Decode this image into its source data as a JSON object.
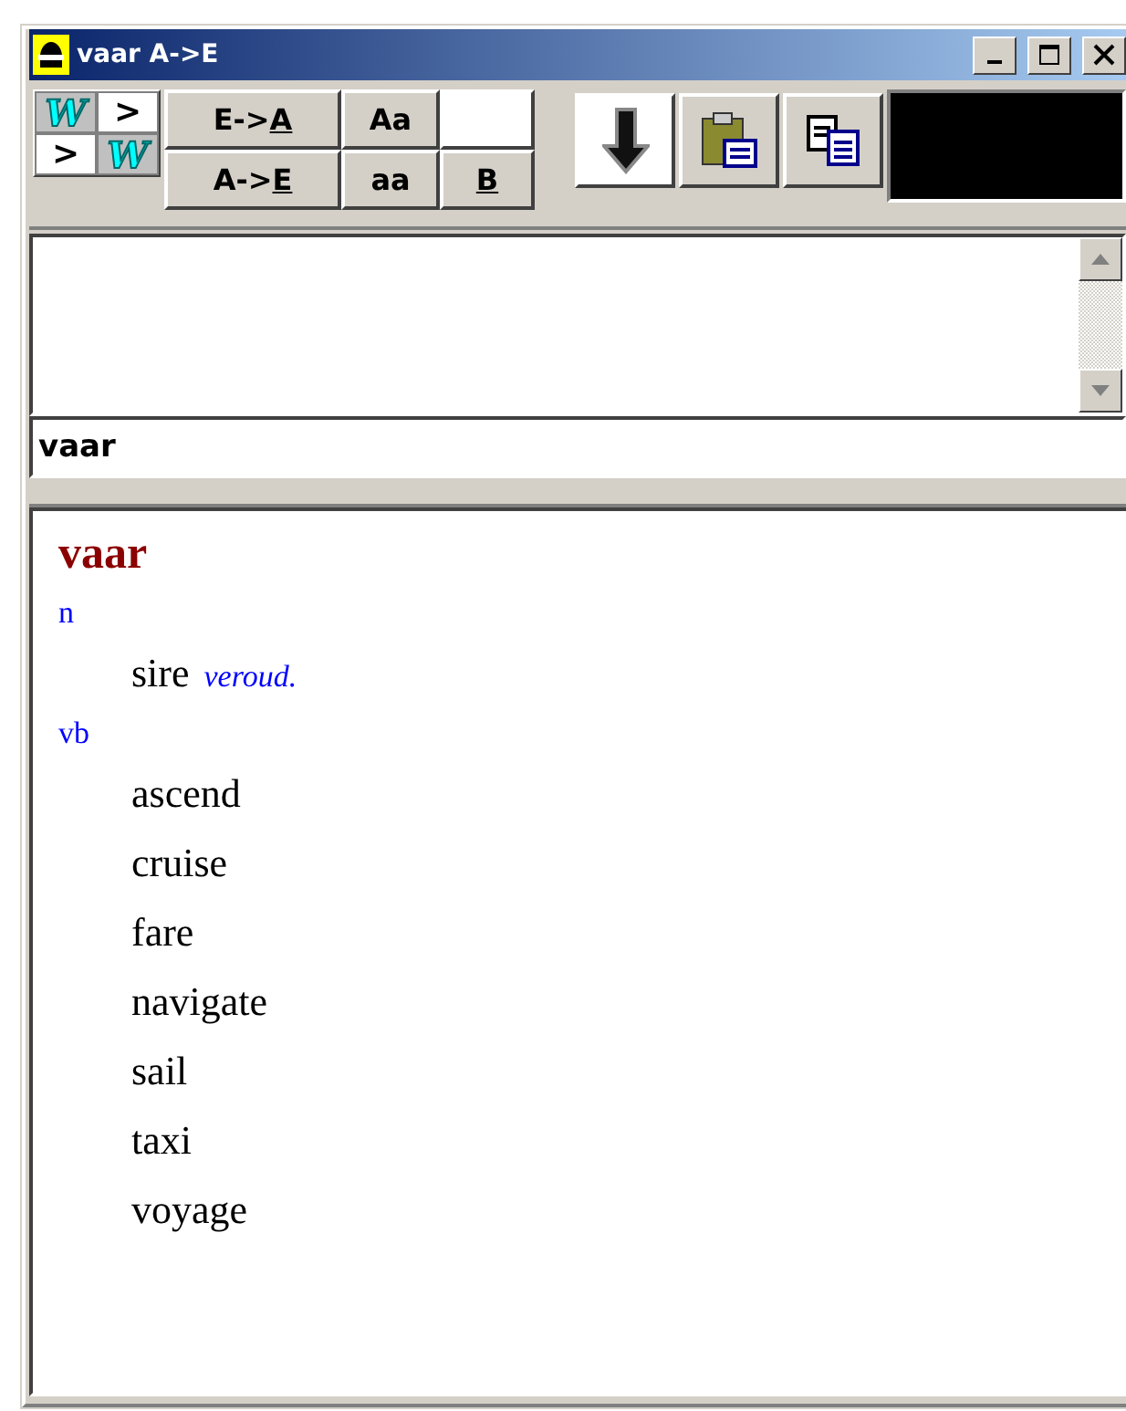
{
  "window": {
    "title": "vaar A->E"
  },
  "direction_toggles": [
    {
      "cells": [
        {
          "text": "W",
          "kind": "logo",
          "lit": false
        },
        {
          "text": ">",
          "kind": "arrow",
          "lit": true
        }
      ]
    },
    {
      "cells": [
        {
          "text": ">",
          "kind": "arrow",
          "lit": true
        },
        {
          "text": "W",
          "kind": "logo",
          "lit": false
        }
      ]
    }
  ],
  "toolbar_buttons": [
    {
      "kind": "label",
      "text": "E->",
      "accel": "A"
    },
    {
      "kind": "label",
      "text": "Aa"
    },
    {
      "kind": "blank"
    },
    {
      "kind": "label",
      "text": "A->",
      "accel": "E"
    },
    {
      "kind": "label",
      "text": "aa"
    },
    {
      "kind": "label",
      "accel": "B"
    }
  ],
  "action_buttons": [
    {
      "kind": "down",
      "pressed": true
    },
    {
      "kind": "paste",
      "pressed": false
    },
    {
      "kind": "copy",
      "pressed": false
    }
  ],
  "search": {
    "value": "vaar"
  },
  "result": {
    "headword": "vaar",
    "groups": [
      {
        "pos": "n",
        "senses": [
          {
            "text": "sire",
            "note": "veroud."
          }
        ]
      },
      {
        "pos": "vb",
        "senses": [
          {
            "text": "ascend"
          },
          {
            "text": "cruise"
          },
          {
            "text": "fare"
          },
          {
            "text": "navigate"
          },
          {
            "text": "sail"
          },
          {
            "text": "taxi"
          },
          {
            "text": "voyage"
          }
        ]
      }
    ]
  }
}
